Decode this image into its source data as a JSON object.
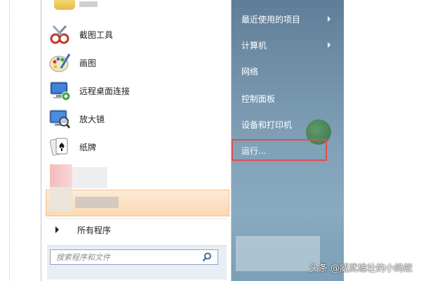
{
  "left_pane": {
    "programs": [
      {
        "label": "截图工具",
        "icon": "scissors-icon"
      },
      {
        "label": "画图",
        "icon": "paint-palette-icon"
      },
      {
        "label": "远程桌面连接",
        "icon": "remote-desktop-icon"
      },
      {
        "label": "放大镜",
        "icon": "magnifier-icon"
      },
      {
        "label": "纸牌",
        "icon": "card-game-icon"
      }
    ],
    "all_programs": "所有程序",
    "search_placeholder": "搜索程序和文件"
  },
  "right_pane": {
    "items": [
      {
        "label": "最近使用的项目",
        "has_submenu": true
      },
      {
        "label": "计算机",
        "has_submenu": true
      },
      {
        "label": "网络",
        "has_submenu": false
      },
      {
        "label": "控制面板",
        "has_submenu": false
      },
      {
        "label": "设备和打印机",
        "has_submenu": false
      },
      {
        "label": "运行...",
        "has_submenu": false,
        "highlighted": true
      }
    ]
  },
  "watermark": "头条 @威武雄壮的小蚂蚁",
  "colors": {
    "highlight_border": "#e04f4f",
    "right_pane_top": "#5f7d97",
    "right_pane_bottom": "#7b9fb7",
    "recent_item_bg": "#fde3c6"
  }
}
